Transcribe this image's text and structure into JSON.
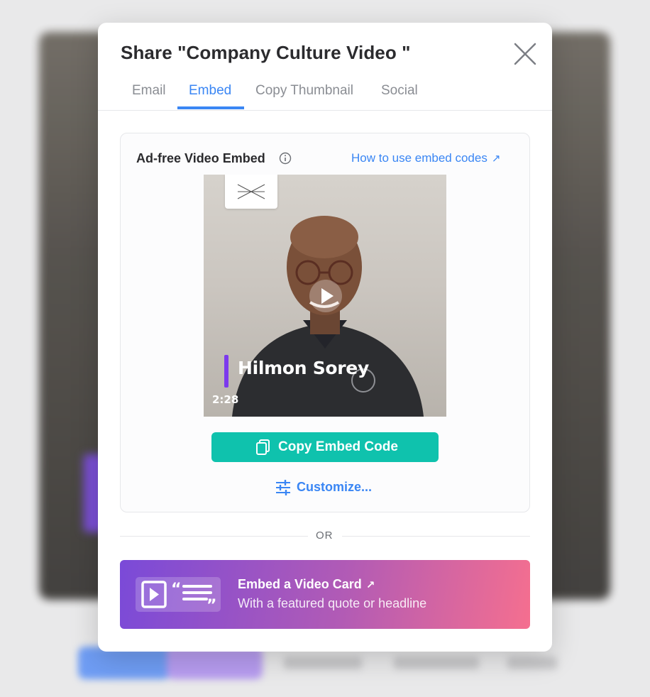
{
  "modal": {
    "title": "Share \"Company Culture Video \"",
    "tabs": [
      {
        "label": "Email",
        "active": false
      },
      {
        "label": "Embed",
        "active": true
      },
      {
        "label": "Copy Thumbnail",
        "active": false
      },
      {
        "label": "Social",
        "active": false
      }
    ],
    "close_icon": "close-icon"
  },
  "embed": {
    "label": "Ad-free Video Embed",
    "info_icon": "info-icon",
    "help_link": "How to use embed codes",
    "help_link_icon": "external-arrow-icon",
    "video": {
      "person_name": "Hilmon Sorey",
      "duration": "2:28",
      "play_icon": "play-icon"
    },
    "copy_button": "Copy Embed Code",
    "copy_icon": "copy-icon",
    "customize_link": "Customize...",
    "customize_icon": "sliders-icon"
  },
  "divider": {
    "text": "OR"
  },
  "video_card": {
    "title": "Embed a Video Card",
    "subtitle": "With a featured quote or headline",
    "icon": "video-card-icon"
  },
  "colors": {
    "accent_blue": "#3a86f4",
    "teal_button": "#0fc2ad",
    "name_bar_purple": "#7c3aed",
    "banner_gradient_start": "#7a4ad8",
    "banner_gradient_end": "#f56f8f"
  }
}
